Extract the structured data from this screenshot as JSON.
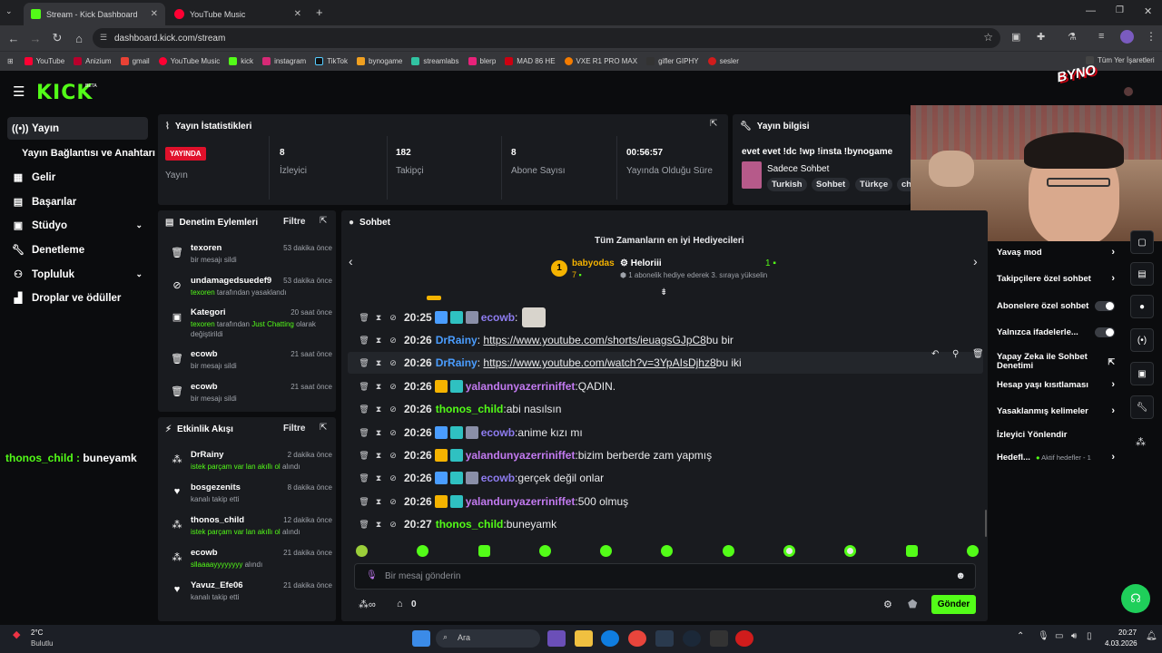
{
  "browser": {
    "tabs": [
      {
        "title": "Stream - Kick Dashboard"
      },
      {
        "title": "YouTube Music"
      }
    ],
    "url": "dashboard.kick.com/stream",
    "bookmarks": [
      "YouTube",
      "Anizium",
      "gmail",
      "YouTube Music",
      "kick",
      "instagram",
      "TikTok",
      "bynogame",
      "streamlabs",
      "blerp",
      "MAD 86 HE",
      "VXE R1 PRO MAX",
      "gifler GIPHY",
      "sesler"
    ],
    "all_bookmarks": "Tüm Yer İşaretleri"
  },
  "brand": {
    "logo": "KICK",
    "beta": "BETA",
    "accent": "#53fc18"
  },
  "sidebar": {
    "items": [
      {
        "label": "Yayın",
        "icon": "broadcast-icon"
      },
      {
        "label": "Yayın Bağlantısı ve Anahtarı",
        "icon": ""
      },
      {
        "label": "Gelir",
        "icon": "revenue-icon"
      },
      {
        "label": "Başarılar",
        "icon": "achievements-icon"
      },
      {
        "label": "Stüdyo",
        "icon": "studio-icon"
      },
      {
        "label": "Denetleme",
        "icon": "wrench-icon"
      },
      {
        "label": "Topluluk",
        "icon": "community-icon"
      },
      {
        "label": "Droplar ve ödüller",
        "icon": "drops-icon"
      }
    ]
  },
  "stats": {
    "title": "Yayın İstatistikleri",
    "live": "YAYINDA",
    "items": [
      {
        "value": "",
        "label": "Yayın"
      },
      {
        "value": "8",
        "label": "İzleyici"
      },
      {
        "value": "182",
        "label": "Takipçi"
      },
      {
        "value": "8",
        "label": "Abone Sayısı"
      },
      {
        "value": "00:56:57",
        "label": "Yayında Olduğu Süre"
      }
    ]
  },
  "info": {
    "title": "Yayın bilgisi",
    "stream_title": "evet evet !dc !wp !insta !bynogame",
    "category": "Sadece Sohbet",
    "tags": [
      "Turkish",
      "Sohbet",
      "Türkçe",
      "ch"
    ]
  },
  "modlog": {
    "title": "Denetim Eylemleri",
    "filter": "Filtre",
    "items": [
      {
        "name": "texoren",
        "time": "53 dakika önce",
        "desc": "bir mesajı sildi"
      },
      {
        "name": "undamagedsuedef9",
        "time": "53 dakika önce",
        "actor": "texoren",
        "desc": "tarafından yasaklandı"
      },
      {
        "name": "Kategori",
        "time": "20 saat önce",
        "actor": "texoren",
        "desc": "tarafından",
        "extra": "Just Chatting",
        "desc2": "olarak değiştirildi"
      },
      {
        "name": "ecowb",
        "time": "21 saat önce",
        "desc": "bir mesajı sildi"
      },
      {
        "name": "ecowb",
        "time": "21 saat önce",
        "desc": "bir mesajı sildi"
      }
    ]
  },
  "activity": {
    "title": "Etkinlik Akışı",
    "filter": "Filtre",
    "items": [
      {
        "name": "DrRainy",
        "time": "2 dakika önce",
        "green": "istek parçam var lan akıllı ol",
        "desc": "alındı"
      },
      {
        "name": "bosgezenits",
        "time": "8 dakika önce",
        "desc": "kanalı takip etti"
      },
      {
        "name": "thonos_child",
        "time": "12 dakika önce",
        "green": "istek parçam var lan akıllı ol",
        "desc": "alındı"
      },
      {
        "name": "ecowb",
        "time": "21 dakika önce",
        "green": "sllaaaayyyyyyyy",
        "desc": "alındı"
      },
      {
        "name": "Yavuz_Efe06",
        "time": "21 dakika önce",
        "desc": "kanalı takip etti"
      }
    ]
  },
  "overlay": {
    "user": "thonos_child",
    "msg": "buneyamk"
  },
  "chat": {
    "title": "Sohbet",
    "gifters_title": "Tüm Zamanların en iyi Hediyecileri",
    "top": {
      "rank": "1",
      "name": "babyodas",
      "count": "7"
    },
    "second": {
      "name": "Heloriii",
      "count": "1",
      "desc": "1 abonelik hediye ederek 3. sıraya yükselin"
    },
    "messages": [
      {
        "time": "20:25",
        "user": "ecowb",
        "color": "#8e7cf0",
        "text": ""
      },
      {
        "time": "20:26",
        "user": "DrRainy",
        "color": "#4a9dff",
        "link": "https://www.youtube.com/shorts/ieuagsGJpC8",
        "text": " bu bir"
      },
      {
        "time": "20:26",
        "user": "DrRainy",
        "color": "#4a9dff",
        "link": "https://www.youtube.com/watch?v=3YpAIsDjhz8",
        "text": " bu iki"
      },
      {
        "time": "20:26",
        "user": "yalandunyazerriniffet",
        "color": "#c27af0",
        "text": " QADIN."
      },
      {
        "time": "20:26",
        "user": "thonos_child",
        "color": "#53fc18",
        "text": " abi nasılsın"
      },
      {
        "time": "20:26",
        "user": "ecowb",
        "color": "#8e7cf0",
        "text": " anime kızı mı"
      },
      {
        "time": "20:26",
        "user": "yalandunyazerriniffet",
        "color": "#c27af0",
        "text": " bizim berberde zam yapmış"
      },
      {
        "time": "20:26",
        "user": "ecowb",
        "color": "#8e7cf0",
        "text": " gerçek değil onlar"
      },
      {
        "time": "20:26",
        "user": "yalandunyazerriniffet",
        "color": "#c27af0",
        "text": " 500 olmuş"
      },
      {
        "time": "20:27",
        "user": "thonos_child",
        "color": "#53fc18",
        "text": " buneyamk"
      }
    ],
    "placeholder": "Bir mesaj gönderin",
    "points": "0",
    "send": "Gönder"
  },
  "controls": {
    "items": [
      {
        "label": "Yavaş mod",
        "type": "arrow"
      },
      {
        "label": "Takipçilere özel sohbet",
        "type": "arrow"
      },
      {
        "label": "Abonelere özel sohbet",
        "type": "toggle"
      },
      {
        "label": "Yalnızca ifadelerle...",
        "type": "toggle"
      },
      {
        "label": "Yapay Zeka ile Sohbet Denetimi",
        "type": "ext"
      },
      {
        "label": "Hesap yaşı kısıtlaması",
        "type": "arrow"
      },
      {
        "label": "Yasaklanmış kelimeler",
        "type": "arrow"
      },
      {
        "label": "İzleyici Yönlendir",
        "type": "none"
      },
      {
        "label": "Hedefl...",
        "type": "arrow",
        "sub": "Aktif hedefler - 1"
      }
    ]
  },
  "webcam": {
    "brand": "BYNO"
  },
  "taskbar": {
    "temp": "2°C",
    "weather": "Bulutlu",
    "search": "Ara",
    "time": "20:27",
    "date": "4.03.2026"
  }
}
